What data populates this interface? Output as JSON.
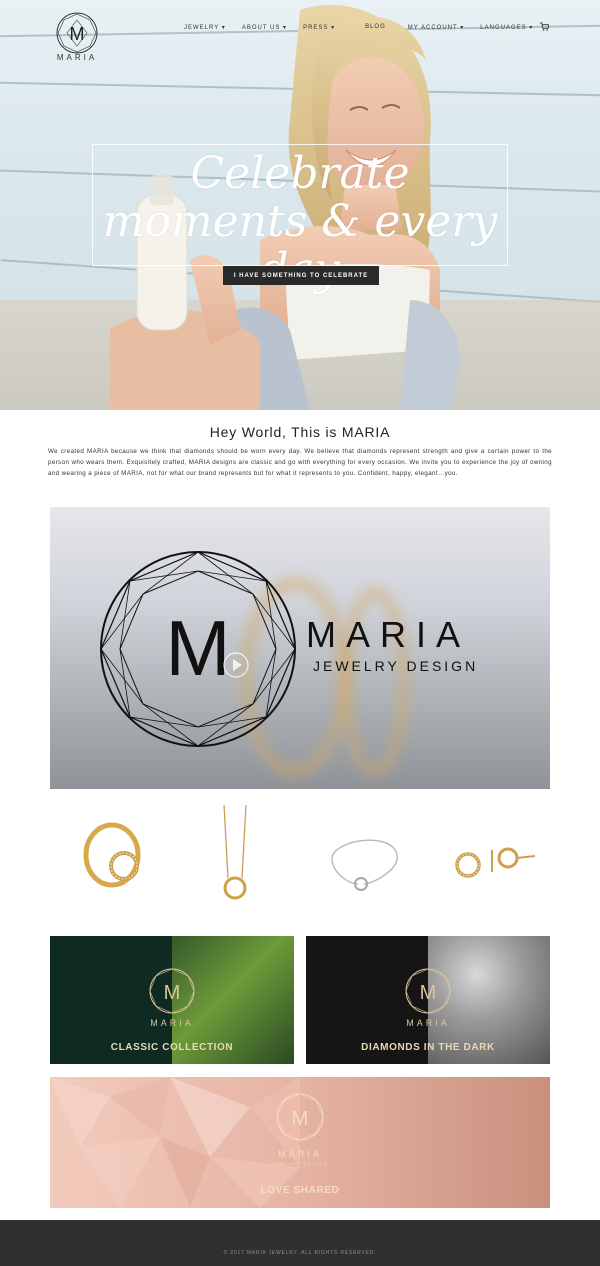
{
  "brand": {
    "name": "MARIA"
  },
  "nav": {
    "items": [
      {
        "label": "JEWELRY"
      },
      {
        "label": "ABOUT US"
      },
      {
        "label": "PRESS"
      },
      {
        "label": "BLOG"
      },
      {
        "label": "MY ACCOUNT"
      },
      {
        "label": "LANGUAGES"
      }
    ],
    "cart_icon": "cart-icon"
  },
  "hero": {
    "title": "Celebrate moments & every day",
    "cta_label": "I HAVE SOMETHING TO CELEBRATE"
  },
  "intro": {
    "title": "Hey World, This is MARIA",
    "body": "We created MARIA because we think that diamonds should be worn every day. We believe that diamonds represent strength and give a certain power to the person who wears them.  Exquisitely crafted, MARIA designs are classic and go with everything for every occasion. We invite you to experience the joy of owning and wearing a piece of MARIA, not for what our brand represents but for what it represents to you.  Confident, happy, elegant…you."
  },
  "video": {
    "brand": "MARIA",
    "subtitle": "JEWELRY DESIGN",
    "play_icon": "play-icon"
  },
  "products": [
    {
      "name": "ring",
      "icon": "ring-icon"
    },
    {
      "name": "necklace",
      "icon": "necklace-icon"
    },
    {
      "name": "bracelet",
      "icon": "bracelet-icon"
    },
    {
      "name": "earrings",
      "icon": "earrings-icon"
    }
  ],
  "collections": [
    {
      "label": "CLASSIC COLLECTION",
      "logo_text": "MARIA",
      "accent": "#0f2a22"
    },
    {
      "label": "DIAMONDS IN THE DARK",
      "logo_text": "MARIA",
      "accent": "#151515"
    },
    {
      "label": "LOVE SHARED",
      "logo_text": "MARIA",
      "logo_sub": "JEWELRY DESIGN",
      "accent": "#d9a99a"
    }
  ],
  "footer": {
    "copyright": "© 2017 MARIA JEWELRY. ALL RIGHTS RESERVED."
  }
}
